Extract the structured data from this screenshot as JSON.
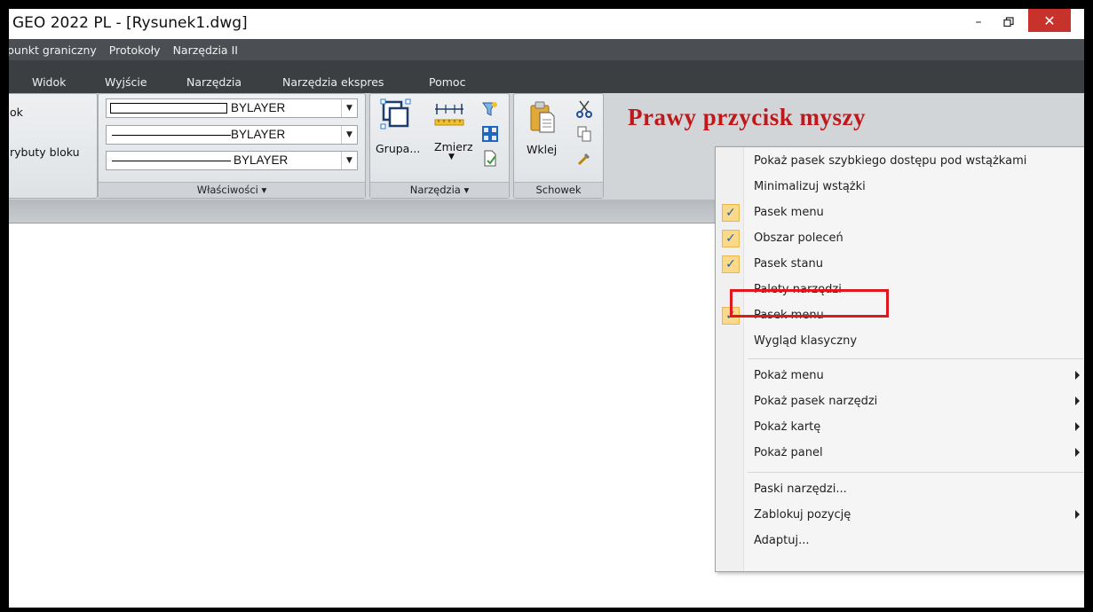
{
  "window": {
    "title": "GEO 2022 PL - [Rysunek1.dwg]",
    "controls": {
      "minimize": "–",
      "restore": "🗗",
      "close": "✕"
    }
  },
  "menubar": {
    "items": [
      "punkt graniczny",
      "Protokoły",
      "Narzędzia II"
    ]
  },
  "ribbon_tabs": [
    "Widok",
    "Wyjście",
    "Narzędzia",
    "Narzędzia ekspres",
    "Pomoc"
  ],
  "ribbon": {
    "left_panel": {
      "label_top": "ok",
      "label_bottom": "rybuty bloku"
    },
    "properties_panel": {
      "footer": "Właściwości ▾",
      "color_value": "BYLAYER",
      "linetype_value": "BYLAYER",
      "lineweight_value": "BYLAYER"
    },
    "tools_panel": {
      "footer": "Narzędzia ▾",
      "group_label": "Grupa...",
      "measure_label": "Zmierz"
    },
    "clipboard_panel": {
      "footer": "Schowek",
      "paste_label": "Wklej"
    }
  },
  "hint_text": "Prawy przycisk myszy",
  "context_menu": {
    "items": [
      {
        "label": "Pokaż pasek szybkiego dostępu pod wstążkami",
        "checked": false,
        "submenu": false
      },
      {
        "label": "Minimalizuj wstążki",
        "checked": false,
        "submenu": false
      },
      {
        "label": "Pasek menu",
        "checked": true,
        "submenu": false
      },
      {
        "label": "Obszar poleceń",
        "checked": true,
        "submenu": false
      },
      {
        "label": "Pasek stanu",
        "checked": true,
        "submenu": false
      },
      {
        "label": "Palety narzędzi",
        "checked": false,
        "submenu": false,
        "highlighted": true
      },
      {
        "label": "Pasek menu",
        "checked": true,
        "submenu": false
      },
      {
        "label": "Wygląd klasyczny",
        "checked": false,
        "submenu": false
      },
      {
        "label": "Pokaż menu",
        "checked": false,
        "submenu": true
      },
      {
        "label": "Pokaż pasek narzędzi",
        "checked": false,
        "submenu": true
      },
      {
        "label": "Pokaż kartę",
        "checked": false,
        "submenu": true
      },
      {
        "label": "Pokaż panel",
        "checked": false,
        "submenu": true
      },
      {
        "label": "Paski narzędzi...",
        "checked": false,
        "submenu": false
      },
      {
        "label": "Zablokuj pozycję",
        "checked": false,
        "submenu": true
      },
      {
        "label": "Adaptuj...",
        "checked": false,
        "submenu": false
      }
    ],
    "checkmark": "✓",
    "highlight_color": "#e0181e"
  },
  "colors": {
    "menubar_bg": "#4b4f53",
    "tabs_bg": "#3c3f42",
    "close_button": "#c7322b",
    "hint": "#c0171b",
    "check_bg": "#fbd98a"
  }
}
